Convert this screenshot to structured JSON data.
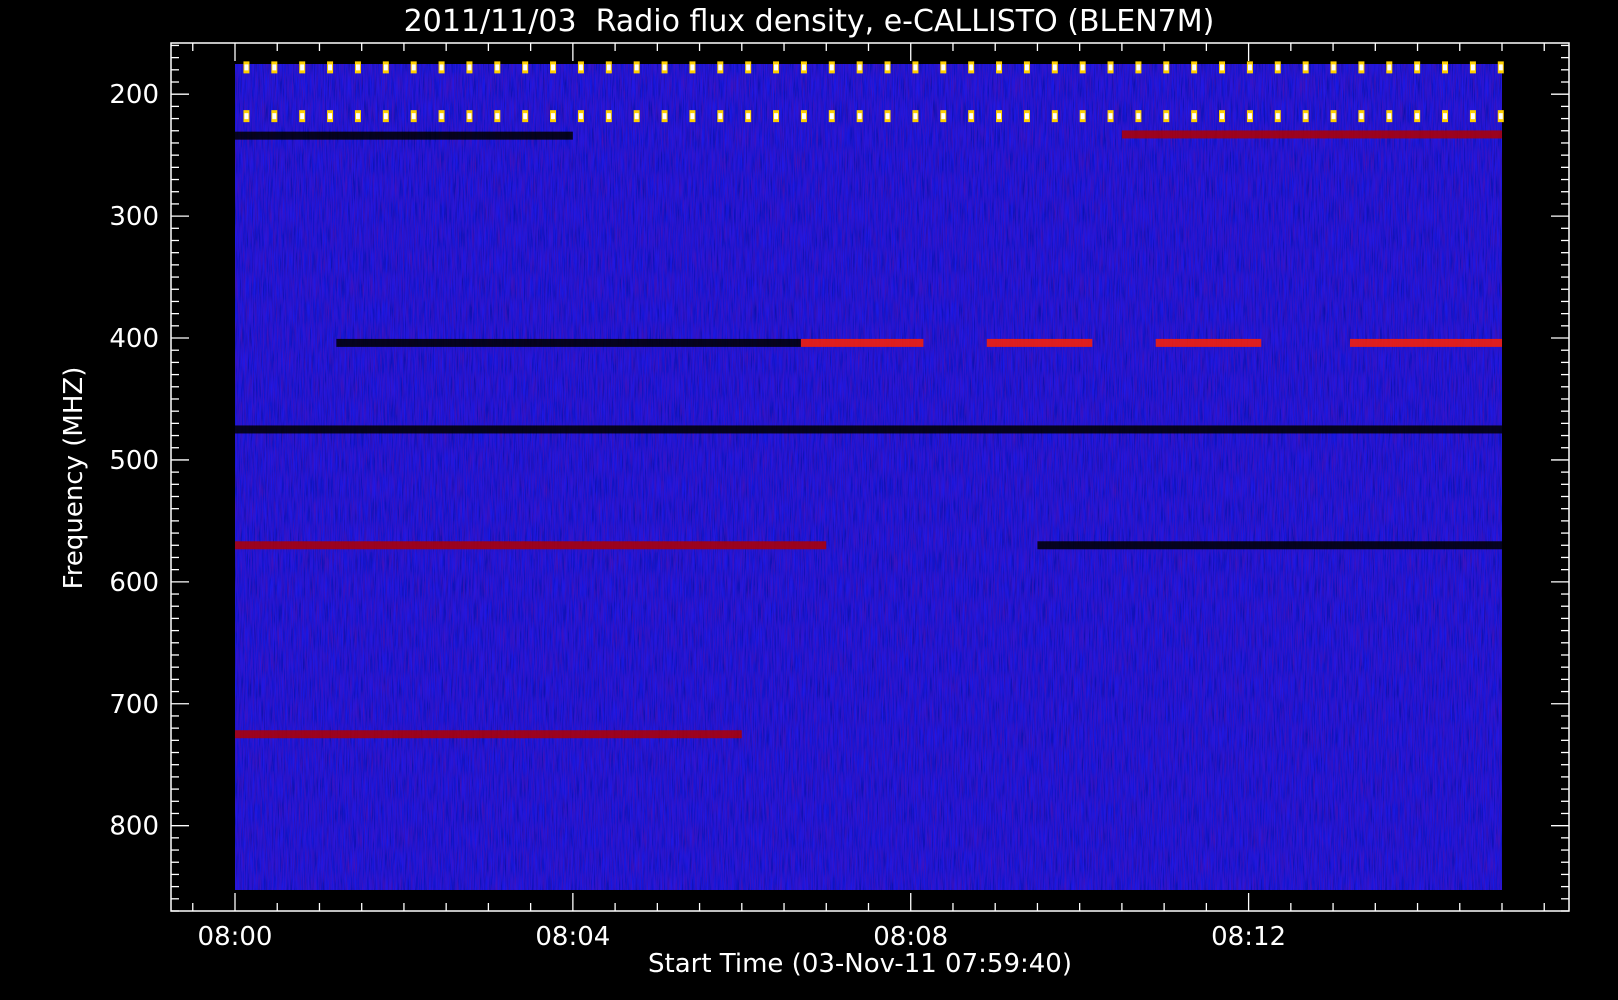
{
  "chart_data": {
    "type": "heatmap",
    "title": "2011/11/03  Radio flux density, e-CALLISTO (BLEN7M)",
    "xlabel": "Start Time (03-Nov-11 07:59:40)",
    "ylabel": "Frequency (MHZ)",
    "x_tick_labels": [
      "08:00",
      "08:04",
      "08:08",
      "08:12"
    ],
    "x_tick_minutes": [
      0,
      4,
      8,
      12
    ],
    "y_tick_labels": [
      "200",
      "300",
      "400",
      "500",
      "600",
      "700",
      "800"
    ],
    "y_ticks": [
      200,
      300,
      400,
      500,
      600,
      700,
      800
    ],
    "xlim_minutes": [
      -0.75,
      15.75
    ],
    "data_xlim_minutes": [
      0.0,
      15.0
    ],
    "ylim_mhz": [
      870,
      158
    ],
    "data_ylim_mhz": [
      175,
      870
    ],
    "colormap": [
      "#000000",
      "#0000ff",
      "#b00000",
      "#ff2000",
      "#ffd000",
      "#ffffff"
    ],
    "background_color": "#1a1aee",
    "features": [
      {
        "kind": "periodic_bursts",
        "freq_mhz": [
          178,
          218
        ],
        "period_minutes": 0.33,
        "color": "#ffd000"
      },
      {
        "kind": "band",
        "freq_mhz": 234,
        "start_min": 0,
        "end_min": 4,
        "color": "#000000"
      },
      {
        "kind": "band",
        "freq_mhz": 233,
        "start_min": 10.5,
        "end_min": 15,
        "color": "#b00000"
      },
      {
        "kind": "band",
        "freq_mhz": 404,
        "start_min": 1.2,
        "end_min": 6.7,
        "color": "#000000"
      },
      {
        "kind": "band",
        "freq_mhz": 404,
        "start_min": 6.7,
        "end_min": 8.15,
        "color": "#ff2000"
      },
      {
        "kind": "band",
        "freq_mhz": 404,
        "start_min": 8.9,
        "end_min": 10.15,
        "color": "#ff2000"
      },
      {
        "kind": "band",
        "freq_mhz": 404,
        "start_min": 10.9,
        "end_min": 12.15,
        "color": "#ff2000"
      },
      {
        "kind": "band",
        "freq_mhz": 404,
        "start_min": 13.2,
        "end_min": 15,
        "color": "#ff2000"
      },
      {
        "kind": "band",
        "freq_mhz": 475,
        "start_min": 0,
        "end_min": 15,
        "color": "#000000"
      },
      {
        "kind": "band",
        "freq_mhz": 570,
        "start_min": 0,
        "end_min": 7,
        "color": "#b00000"
      },
      {
        "kind": "band",
        "freq_mhz": 570,
        "start_min": 9.5,
        "end_min": 15,
        "color": "#000000"
      },
      {
        "kind": "band",
        "freq_mhz": 725,
        "start_min": 0,
        "end_min": 6,
        "color": "#b00000"
      }
    ]
  }
}
